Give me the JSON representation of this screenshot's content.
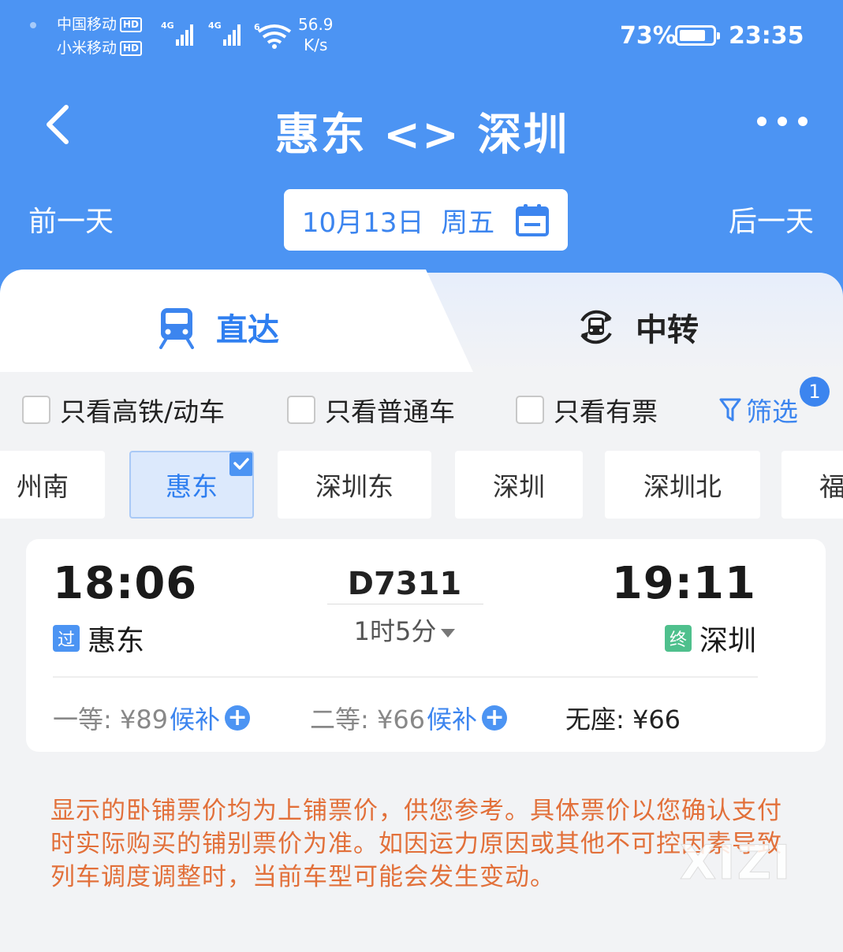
{
  "status_bar": {
    "carrier1": "中国移动",
    "carrier2": "小米移动",
    "hd": "HD",
    "net1": "4G",
    "net2": "4G",
    "wifi_label": "6",
    "speed_value": "56.9",
    "speed_unit": "K/s",
    "battery": "73%",
    "time": "23:35"
  },
  "header": {
    "title": "惠东 <> 深圳",
    "back_icon": "chevron-left-icon",
    "more_icon": "more-dots-icon"
  },
  "date_bar": {
    "prev_day": "前一天",
    "date": "10月13日  周五",
    "next_day": "后一天",
    "calendar_icon": "calendar-icon"
  },
  "tabs": {
    "direct": "直达",
    "transfer": "中转",
    "active": "direct"
  },
  "filters": {
    "high_speed": "只看高铁/动车",
    "normal": "只看普通车",
    "available": "只看有票",
    "filter_label": "筛选",
    "filter_badge": "1"
  },
  "stations": [
    {
      "label": "州南",
      "selected": false
    },
    {
      "label": "惠东",
      "selected": true
    },
    {
      "label": "深圳东",
      "selected": false
    },
    {
      "label": "深圳",
      "selected": false
    },
    {
      "label": "深圳北",
      "selected": false
    },
    {
      "label": "福",
      "selected": false
    }
  ],
  "train": {
    "departure_time": "18:06",
    "departure_station": "惠东",
    "departure_tag": "过",
    "train_number": "D7311",
    "duration": "1时5分",
    "arrival_time": "19:11",
    "arrival_station": "深圳",
    "arrival_tag": "终",
    "seats": [
      {
        "label": "一等: ¥89",
        "status": "候补"
      },
      {
        "label": "二等: ¥66",
        "status": "候补"
      },
      {
        "label": "无座: ¥66",
        "status": ""
      }
    ]
  },
  "notice": "显示的卧铺票价均为上铺票价，供您参考。具体票价以您确认支付时实际购买的铺别票价为准。如因运力原因或其他不可控因素导致列车调度调整时，当前车型可能会发生变动。",
  "watermark": "XIZI",
  "colors": {
    "primary": "#4c94f3",
    "accent_text": "#3c85ef",
    "notice": "#e2703a",
    "end_tag": "#4fc08d"
  }
}
